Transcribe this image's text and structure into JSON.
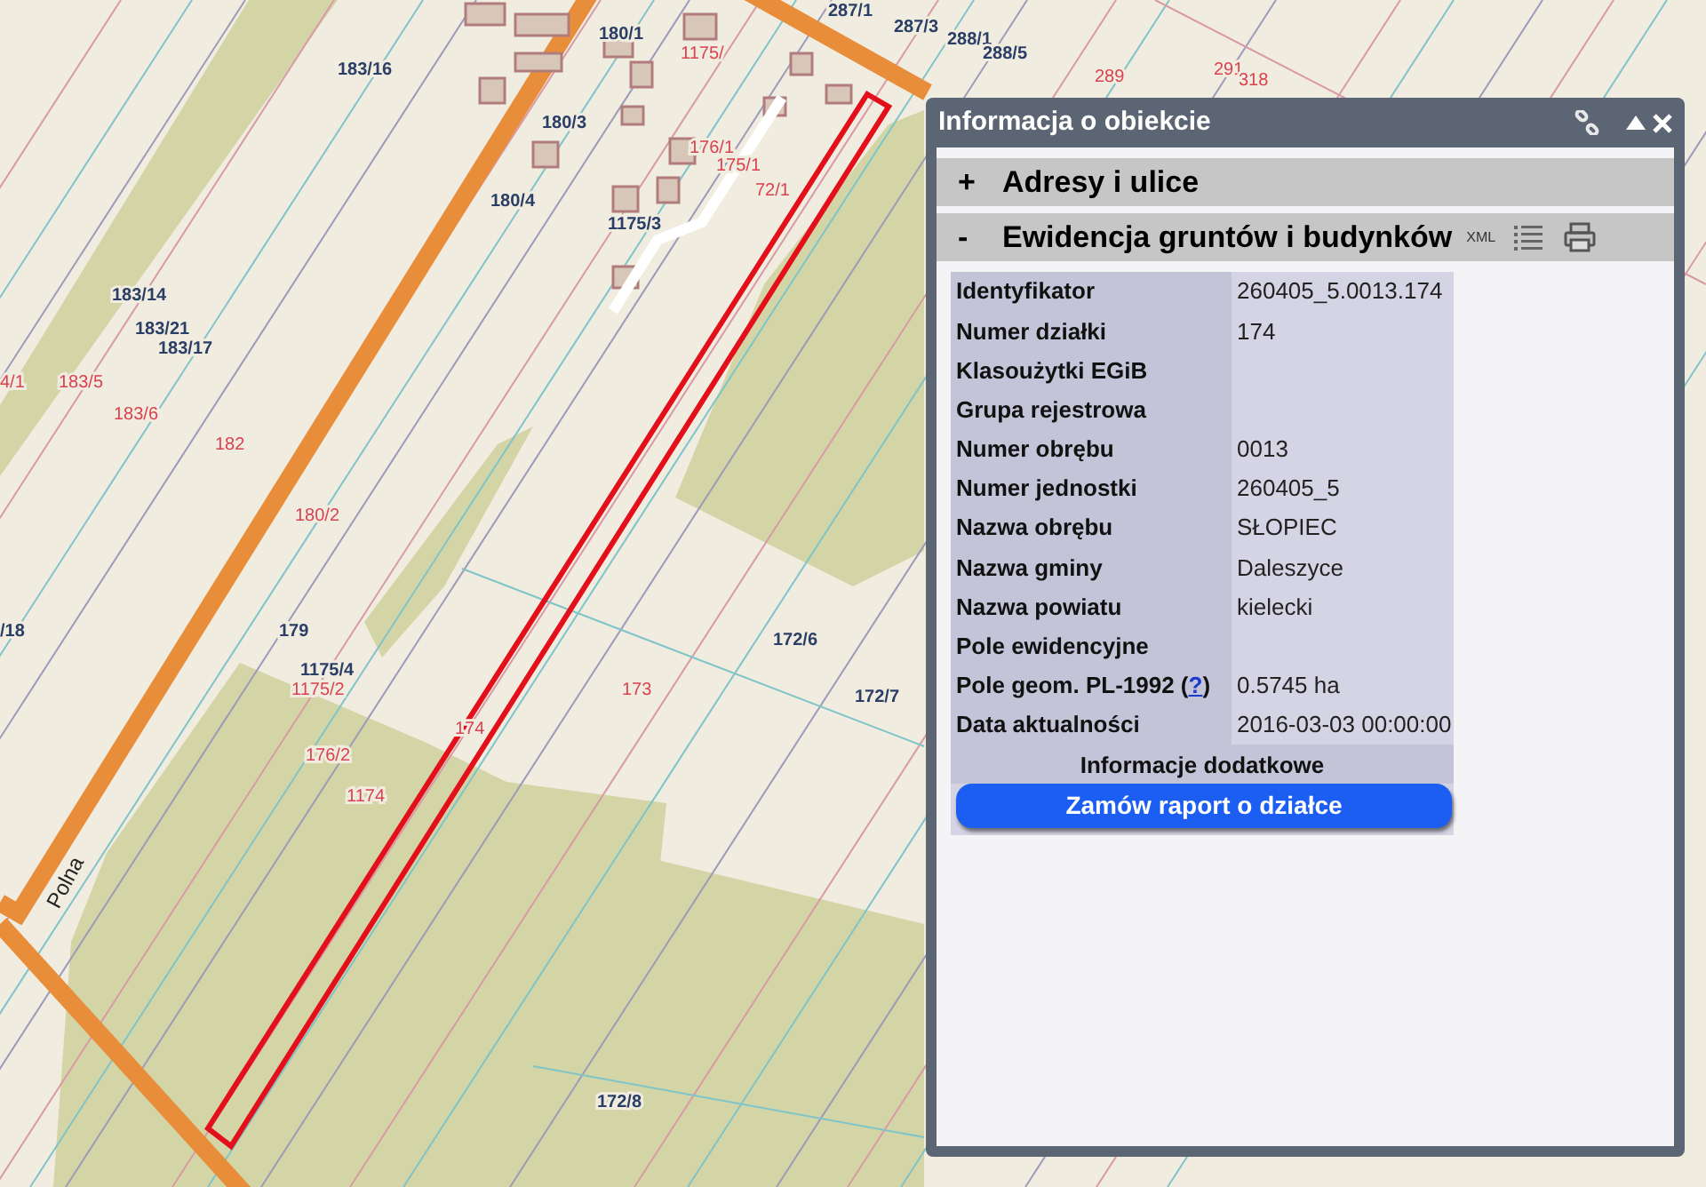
{
  "map": {
    "labels": [
      {
        "text": "287/1",
        "color": "#2b3f66"
      },
      {
        "text": "287/3",
        "color": "#2b3f66"
      },
      {
        "text": "288/1",
        "color": "#2b3f66"
      },
      {
        "text": "288/5",
        "color": "#2b3f66"
      },
      {
        "text": "289",
        "color": "#d9434f"
      },
      {
        "text": "291",
        "color": "#d9434f"
      },
      {
        "text": "318",
        "color": "#d9434f"
      },
      {
        "text": "180/1",
        "color": "#2b3f66"
      },
      {
        "text": "1175/",
        "color": "#d9434f"
      },
      {
        "text": "183/16",
        "color": "#2b3f66"
      },
      {
        "text": "180/3",
        "color": "#2b3f66"
      },
      {
        "text": "176/1",
        "color": "#d9434f"
      },
      {
        "text": "175/1",
        "color": "#d9434f"
      },
      {
        "text": "72/1",
        "color": "#d9434f"
      },
      {
        "text": "180/4",
        "color": "#2b3f66"
      },
      {
        "text": "1175/3",
        "color": "#2b3f66"
      },
      {
        "text": "183/14",
        "color": "#2b3f66"
      },
      {
        "text": "183/21",
        "color": "#2b3f66"
      },
      {
        "text": "183/17",
        "color": "#2b3f66"
      },
      {
        "text": "4/1",
        "color": "#d9434f"
      },
      {
        "text": "183/5",
        "color": "#d9434f"
      },
      {
        "text": "183/6",
        "color": "#d9434f"
      },
      {
        "text": "182",
        "color": "#d9434f"
      },
      {
        "text": "180/2",
        "color": "#d9434f"
      },
      {
        "text": "/18",
        "color": "#2b3f66"
      },
      {
        "text": "179",
        "color": "#2b3f66"
      },
      {
        "text": "1175/4",
        "color": "#2b3f66"
      },
      {
        "text": "1175/2",
        "color": "#d9434f"
      },
      {
        "text": "173",
        "color": "#d9434f"
      },
      {
        "text": "172/6",
        "color": "#2b3f66"
      },
      {
        "text": "172/7",
        "color": "#2b3f66"
      },
      {
        "text": "174",
        "color": "#d9434f"
      },
      {
        "text": "176/2",
        "color": "#d9434f"
      },
      {
        "text": "1174",
        "color": "#d9434f"
      },
      {
        "text": "172/8",
        "color": "#2b3f66"
      }
    ],
    "street": "Polna"
  },
  "panel": {
    "title": "Informacja o obiekcie",
    "sections": [
      {
        "toggle": "+",
        "title": "Adresy i ulice"
      },
      {
        "toggle": "-",
        "title": "Ewidencja gruntów i budynków",
        "xml": "XML",
        "rows": [
          {
            "label": "Identyfikator",
            "value": "260405_5.0013.174"
          },
          {
            "label": "Numer działki",
            "value": "174"
          },
          {
            "label": "Klasoużytki EGiB"
          },
          {
            "label": "Grupa rejestrowa"
          },
          {
            "label": "Numer obrębu",
            "value": "0013"
          },
          {
            "label": "Numer jednostki",
            "value": "260405_5"
          },
          {
            "label": "Nazwa obrębu",
            "value": "SŁOPIEC"
          },
          {
            "label": "Nazwa gminy",
            "value": "Daleszyce"
          },
          {
            "label": "Nazwa powiatu",
            "value": "kielecki"
          },
          {
            "label": "Pole ewidencyjne"
          },
          {
            "label": "Pole geom. PL-1992 (",
            "link": "?",
            "label_after": ")",
            "value": "0.5745 ha"
          },
          {
            "label": "Data aktualności",
            "value": "2016-03-03 00:00:00"
          }
        ],
        "footer": "Informacje dodatkowe",
        "button": "Zamów raport o działce"
      }
    ]
  }
}
